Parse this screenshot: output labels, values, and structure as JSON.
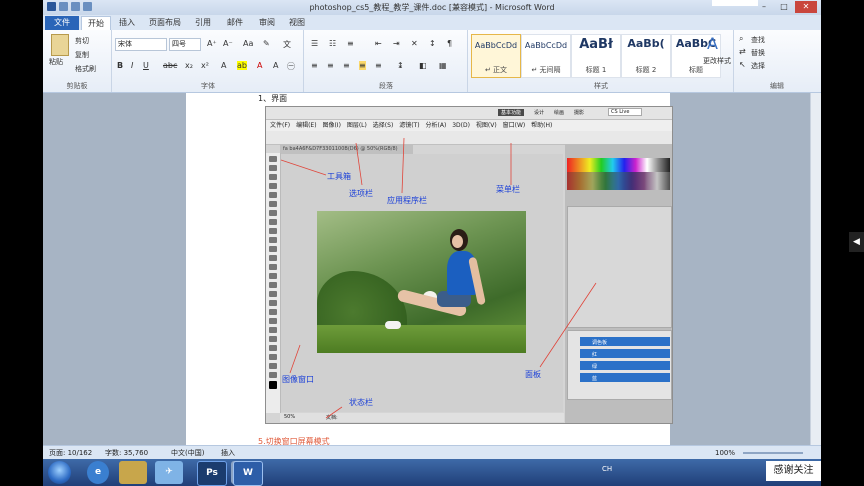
{
  "title": "photoshop_cs5_教程_教学_课件.doc [兼容模式] - Microsoft Word",
  "tabs": [
    "文件",
    "开始",
    "插入",
    "页面布局",
    "引用",
    "邮件",
    "审阅",
    "视图"
  ],
  "clipboard": {
    "paste": "粘贴",
    "cut": "剪切",
    "copy": "复制",
    "format_painter": "格式刷",
    "label": "剪贴板"
  },
  "font": {
    "name": "宋体",
    "size": "四号",
    "label": "字体"
  },
  "paragraph": {
    "label": "段落"
  },
  "styles": {
    "items": [
      {
        "sample": "AaBbCcDd",
        "name": "↵ 正文"
      },
      {
        "sample": "AaBbCcDd",
        "name": "↵ 无间隔"
      },
      {
        "sample": "AaBł",
        "name": "标题 1"
      },
      {
        "sample": "AaBb(",
        "name": "标题 2"
      },
      {
        "sample": "AaBbC",
        "name": "标题"
      }
    ],
    "change": "更改样式",
    "label": "样式"
  },
  "editing": {
    "find": "查找",
    "replace": "替换",
    "select": "选择",
    "label": "编辑"
  },
  "doc": {
    "heading": "1、界面",
    "footer": "5.切换窗口屏幕模式"
  },
  "ps": {
    "menu": [
      "文件(F)",
      "编辑(E)",
      "图像(I)",
      "图层(L)",
      "选择(S)",
      "滤镜(T)",
      "分析(A)",
      "3D(D)",
      "视图(V)",
      "窗口(W)",
      "帮助(H)"
    ],
    "doctab": "fa ba4A6F&D7F3301100B(D6) @ 50%(RGB/8)",
    "topbtns": [
      "基本功能",
      "设计",
      "绘画",
      "摄影"
    ],
    "search": "CS Live",
    "status": "50%",
    "status2": "文档:",
    "layers": [
      "调色板",
      "红",
      "绿",
      "蓝"
    ]
  },
  "annotations": {
    "toolbox": "工具箱",
    "options": "选项栏",
    "appbar": "应用程序栏",
    "menubar": "菜单栏",
    "image_window": "图像窗口",
    "panel": "面板",
    "statusbar": "状态栏"
  },
  "status": {
    "page": "页面: 10/162",
    "words": "字数: 35,760",
    "lang": "中文(中国)",
    "insert": "插入",
    "zoom": "100%"
  },
  "taskbar": {
    "ps": "Ps",
    "word": "W",
    "tray": "CH"
  },
  "watermark": "感谢关注"
}
